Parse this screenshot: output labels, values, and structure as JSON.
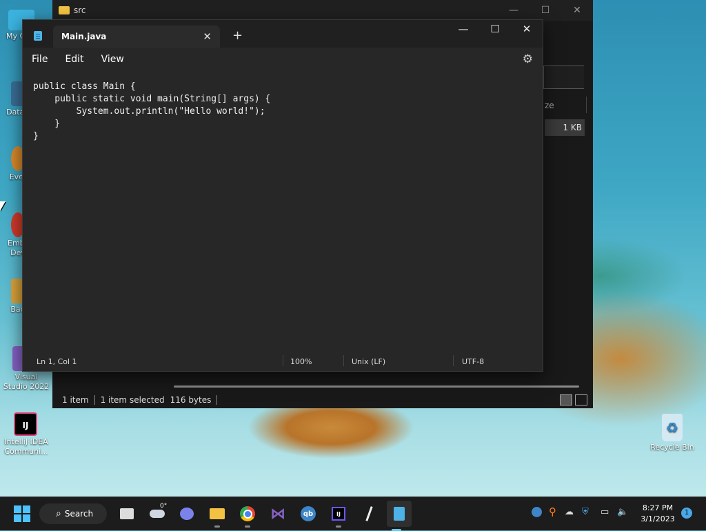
{
  "desktop": {
    "icons": [
      {
        "label": "My Co"
      },
      {
        "label": "DataV"
      },
      {
        "label": "Ever"
      },
      {
        "label": "Emba Dev"
      },
      {
        "label": "Bad"
      },
      {
        "label": "Visual Studio 2022"
      },
      {
        "label": "IntelliJ IDEA Communi..."
      },
      {
        "label": "Recycle Bin"
      }
    ]
  },
  "explorer": {
    "title": "src",
    "column_size": "ze",
    "row_size": "1 KB",
    "status": {
      "count": "1 item",
      "selected": "1 item selected",
      "size": "116 bytes"
    }
  },
  "notepad": {
    "tab_title": "Main.java",
    "new_tab": "+",
    "menu": {
      "file": "File",
      "edit": "Edit",
      "view": "View"
    },
    "code": "public class Main {\n    public static void main(String[] args) {\n        System.out.println(\"Hello world!\");\n    }\n}",
    "status": {
      "position": "Ln 1, Col 1",
      "zoom": "100%",
      "line_ending": "Unix (LF)",
      "encoding": "UTF-8"
    }
  },
  "taskbar": {
    "search_label": "Search",
    "weather": "0°",
    "clock_time": "8:27 PM",
    "clock_date": "3/1/2023",
    "notification_count": "1",
    "accent": "#60cdff"
  }
}
